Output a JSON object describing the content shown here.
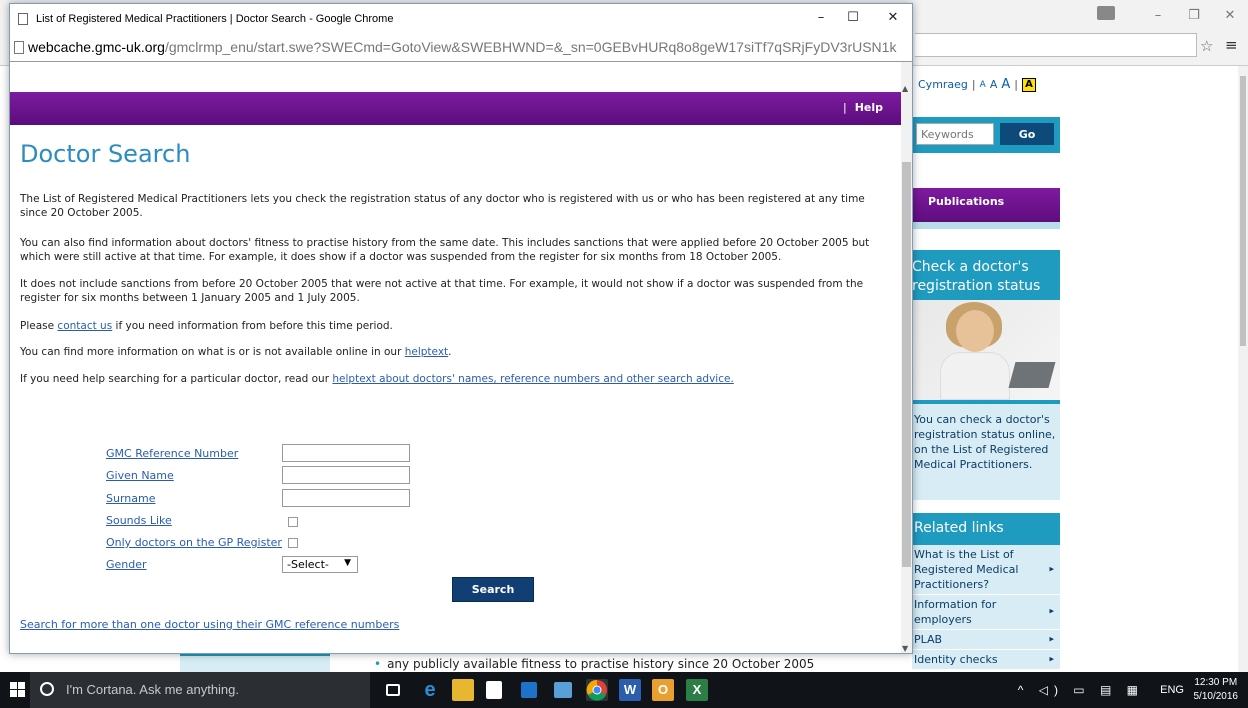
{
  "background": {
    "lang": {
      "cymraeg": "Cymraeg",
      "sep": "|",
      "size_small": "A",
      "size_medium": "A",
      "size_large": "A",
      "contrast": "A"
    },
    "search": {
      "placeholder": "Keywords",
      "go": "Go"
    },
    "publications": "Publications",
    "check_box": {
      "title_line1": "Check a doctor's",
      "title_line2": "registration status",
      "text": "You can check a doctor's registration status online, on the List of Registered Medical Practitioners."
    },
    "related_links": {
      "title": "Related links",
      "items": [
        "What is the List of Registered Medical Practitioners?",
        "Information for employers",
        "PLAB",
        "Identity checks"
      ]
    },
    "bullet_text": "any publicly available fitness to practise history since 20 October 2005"
  },
  "popup": {
    "window_title": "List of Registered Medical Practitioners | Doctor Search - Google Chrome",
    "controls": {
      "minimize": "–",
      "maximize": "☐",
      "close": "✕"
    },
    "address": {
      "host": "webcache.gmc-uk.org",
      "path": "/gmclrmp_enu/start.swe?SWECmd=GotoView&SWEBHWND=&_sn=0GEBvHURq8o8geW17siTf7qSRjFyDV3rUSN1k"
    },
    "help_sep": "|",
    "help": "Help",
    "title": "Doctor Search",
    "p1": "The List of Registered Medical Practitioners lets you check the registration status of any doctor who is registered with us or who has been registered at any time since 20 October 2005.",
    "p2": "You can also find information about doctors' fitness to practise history from the same date. This includes sanctions that were applied before 20 October 2005 but which were still active at that time. For example, it does show if a doctor was suspended from the register for six months from 18 October 2005.",
    "p3": "It does not include sanctions from before 20 October 2005 that were not active at that time. For example, it would not show if a doctor was suspended from the register for six months between 1 January 2005 and 1 July 2005.",
    "p4_pre": "Please ",
    "p4_link": "contact us",
    "p4_post": " if you need information from before this time period.",
    "p5_pre": "You can find more information on what is or is not available online in our ",
    "p5_link": "helptext",
    "p5_post": ".",
    "p6_pre": "If you need help searching for a particular doctor, read our ",
    "p6_link": "helptext about doctors' names, reference numbers and other search advice.",
    "form": {
      "gmc_ref": "GMC Reference Number",
      "given_name": "Given Name",
      "surname": "Surname",
      "sounds_like": "Sounds Like",
      "gp_only": "Only doctors on the GP Register",
      "gender": "Gender",
      "gender_value": "-Select-",
      "search": "Search"
    },
    "multi_link": "Search for more than one doctor using their GMC reference numbers"
  },
  "taskbar": {
    "cortana": "I'm Cortana. Ask me anything.",
    "lang": "ENG",
    "time": "12:30 PM",
    "date": "5/10/2016",
    "apps": [
      "task-view",
      "edge",
      "file-explorer",
      "store",
      "media",
      "photos",
      "chrome",
      "word",
      "outlook",
      "excel"
    ]
  },
  "colors": {
    "purple": "#6a1390",
    "accent_blue": "#1f9bc0",
    "title_blue": "#2a8cc0",
    "button_navy": "#123f73"
  }
}
